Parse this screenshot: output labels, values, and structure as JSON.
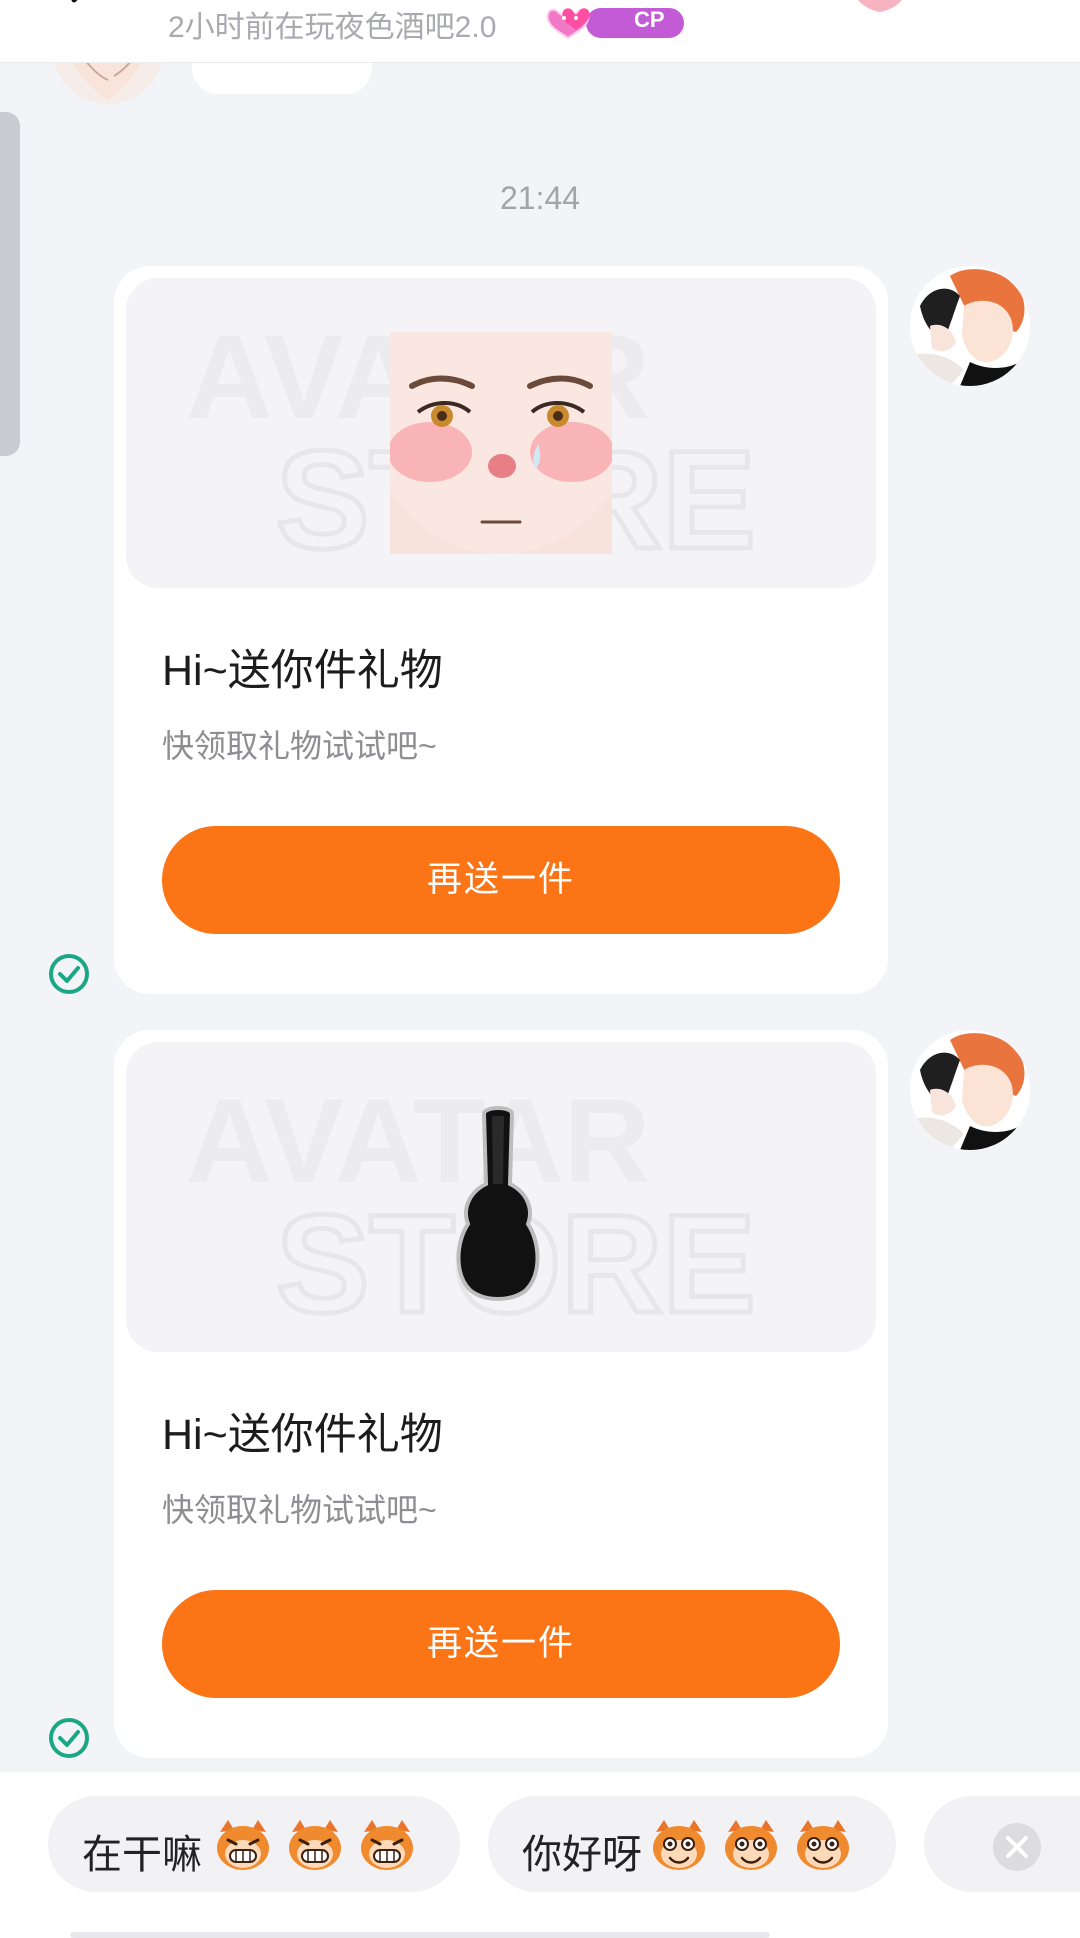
{
  "header": {
    "status_text": "2小时前在玩夜色酒吧2.0",
    "badge_label": "CP"
  },
  "chat": {
    "timestamp": "21:44",
    "messages": [
      {
        "image_icon": "face-blush-gift",
        "title": "Hi~送你件礼物",
        "subtitle": "快领取礼物试试吧~",
        "button_label": "再送一件",
        "sent": true
      },
      {
        "image_icon": "guitar-case-gift",
        "title": "Hi~送你件礼物",
        "subtitle": "快领取礼物试试吧~",
        "button_label": "再送一件",
        "sent": true
      }
    ]
  },
  "quick_replies": [
    {
      "label": "在干嘛",
      "emoji_icon": "laughing-monkey-icon",
      "emoji_count": 3
    },
    {
      "label": "你好呀",
      "emoji_icon": "smiling-monkey-icon",
      "emoji_count": 3
    }
  ],
  "colors": {
    "accent": "#FB7416",
    "check": "#1BA784",
    "background": "#F3F4F8"
  }
}
